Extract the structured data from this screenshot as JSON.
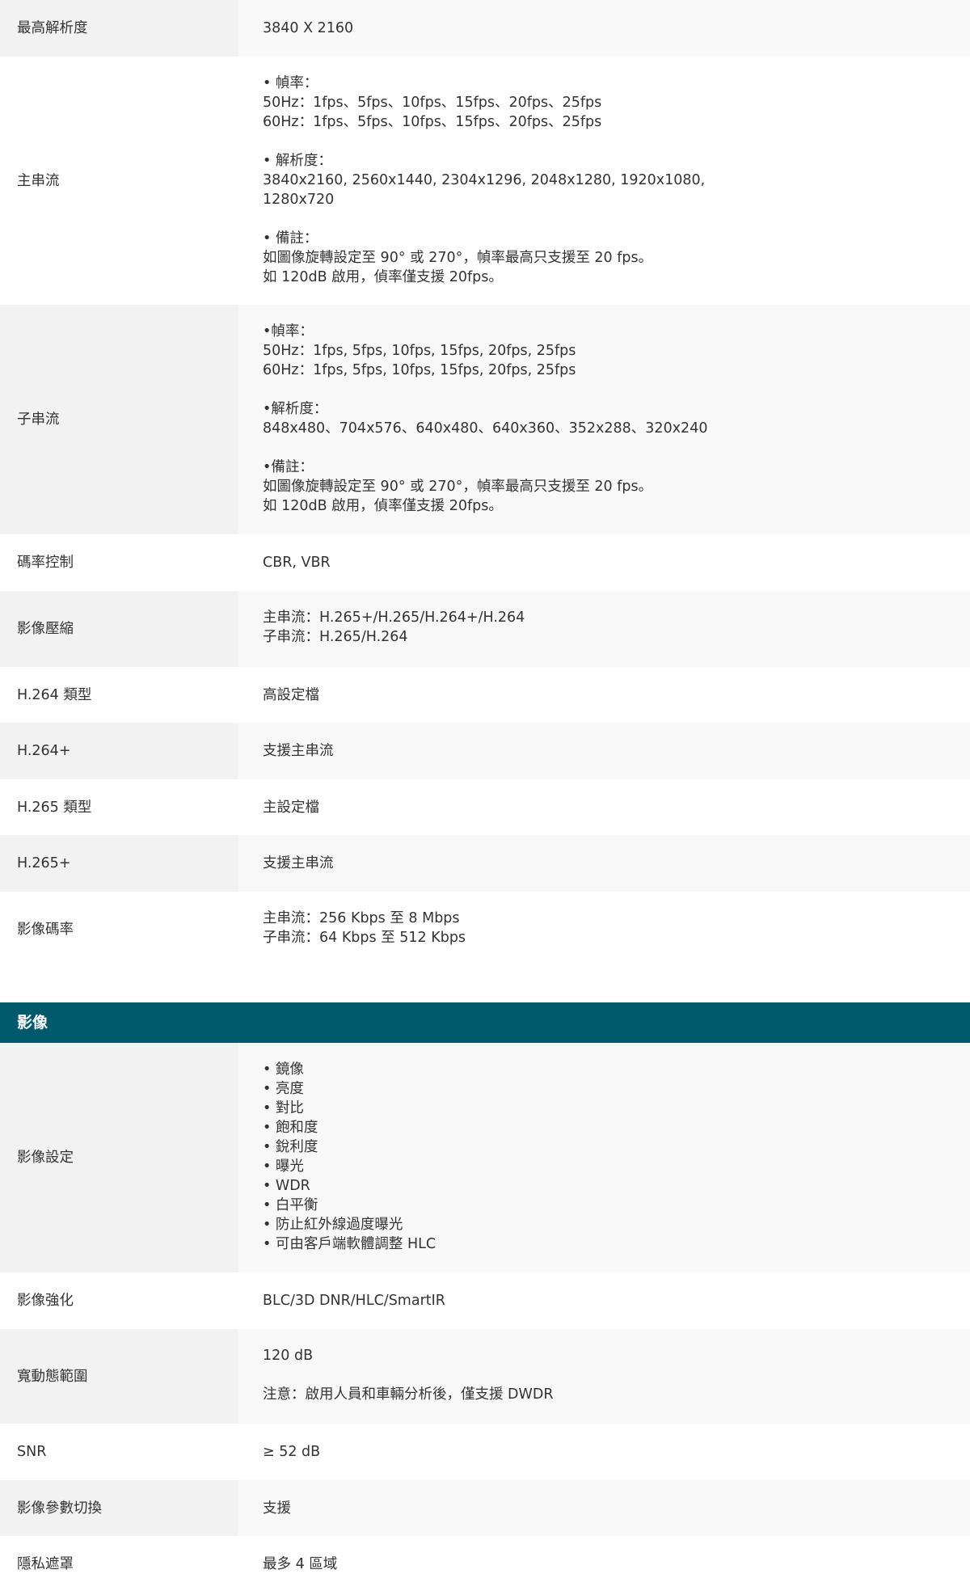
{
  "rows_video": [
    {
      "label": "最高解析度",
      "lines": [
        "3840 X 2160"
      ],
      "shade": true,
      "h": 70
    },
    {
      "label": "主串流",
      "lines": [
        "• 幀率：",
        "50Hz：1fps、5fps、10fps、15fps、20fps、25fps",
        "60Hz：1fps、5fps、10fps、15fps、20fps、25fps",
        "",
        "• 解析度：",
        "3840x2160, 2560x1440, 2304x1296, 2048x1280, 1920x1080,",
        "1280x720",
        "",
        "• 備註：",
        "如圖像旋轉設定至 90° 或 270°，幀率最高只支援至 20 fps。",
        "如 120dB 啟用，偵率僅支援 20fps。"
      ],
      "shade": false,
      "h": 307
    },
    {
      "label": "子串流",
      "lines": [
        "•幀率：",
        "50Hz：1fps, 5fps, 10fps, 15fps, 20fps, 25fps",
        "60Hz：1fps, 5fps, 10fps, 15fps, 20fps, 25fps",
        "",
        "•解析度：",
        "848x480、704x576、640x480、640x360、352x288、320x240",
        "",
        "•備註：",
        "如圖像旋轉設定至 90° 或 270°，幀率最高只支援至 20 fps。",
        "如 120dB 啟用，偵率僅支援 20fps。"
      ],
      "shade": true,
      "h": 284
    },
    {
      "label": "碼率控制",
      "lines": [
        "CBR, VBR"
      ],
      "shade": false,
      "h": 70
    },
    {
      "label": "影像壓縮",
      "lines": [
        "主串流：H.265+/H.265/H.264+/H.264",
        "子串流：H.265/H.264"
      ],
      "shade": true,
      "h": 94
    },
    {
      "label": "H.264 類型",
      "lines": [
        "高設定檔"
      ],
      "shade": false,
      "h": 69
    },
    {
      "label": "H.264+",
      "lines": [
        "支援主串流"
      ],
      "shade": true,
      "h": 70
    },
    {
      "label": "H.265 類型",
      "lines": [
        "主設定檔"
      ],
      "shade": false,
      "h": 69
    },
    {
      "label": "H.265+",
      "lines": [
        "支援主串流"
      ],
      "shade": true,
      "h": 70
    },
    {
      "label": "影像碼率",
      "lines": [
        "主串流：256 Kbps 至 8 Mbps",
        "子串流：64 Kbps 至 512 Kbps"
      ],
      "shade": false,
      "h": 94
    }
  ],
  "section_image": {
    "title": "影像"
  },
  "rows_image": [
    {
      "label": "影像設定",
      "lines": [
        "• 鏡像",
        "• 亮度",
        "• 對比",
        "• 飽和度",
        "• 銳利度",
        "• 曝光",
        "• WDR",
        "• 白平衡",
        "• 防止紅外線過度曝光",
        "• 可由客戶端軟體調整 HLC"
      ],
      "shade": true,
      "h": 284
    },
    {
      "label": "影像強化",
      "lines": [
        "BLC/3D DNR/HLC/SmartIR"
      ],
      "shade": false,
      "h": 70
    },
    {
      "label": "寬動態範圍",
      "lines": [
        "120 dB",
        "",
        "注意：啟用人員和車輛分析後，僅支援 DWDR"
      ],
      "shade": true,
      "h": 117
    },
    {
      "label": "SNR",
      "lines": [
        "≥ 52 dB"
      ],
      "shade": false,
      "h": 70
    },
    {
      "label": "影像參數切換",
      "lines": [
        "支援"
      ],
      "shade": true,
      "h": 69
    },
    {
      "label": "隱私遮罩",
      "lines": [
        "最多 4 區域"
      ],
      "shade": false,
      "h": 70
    }
  ]
}
